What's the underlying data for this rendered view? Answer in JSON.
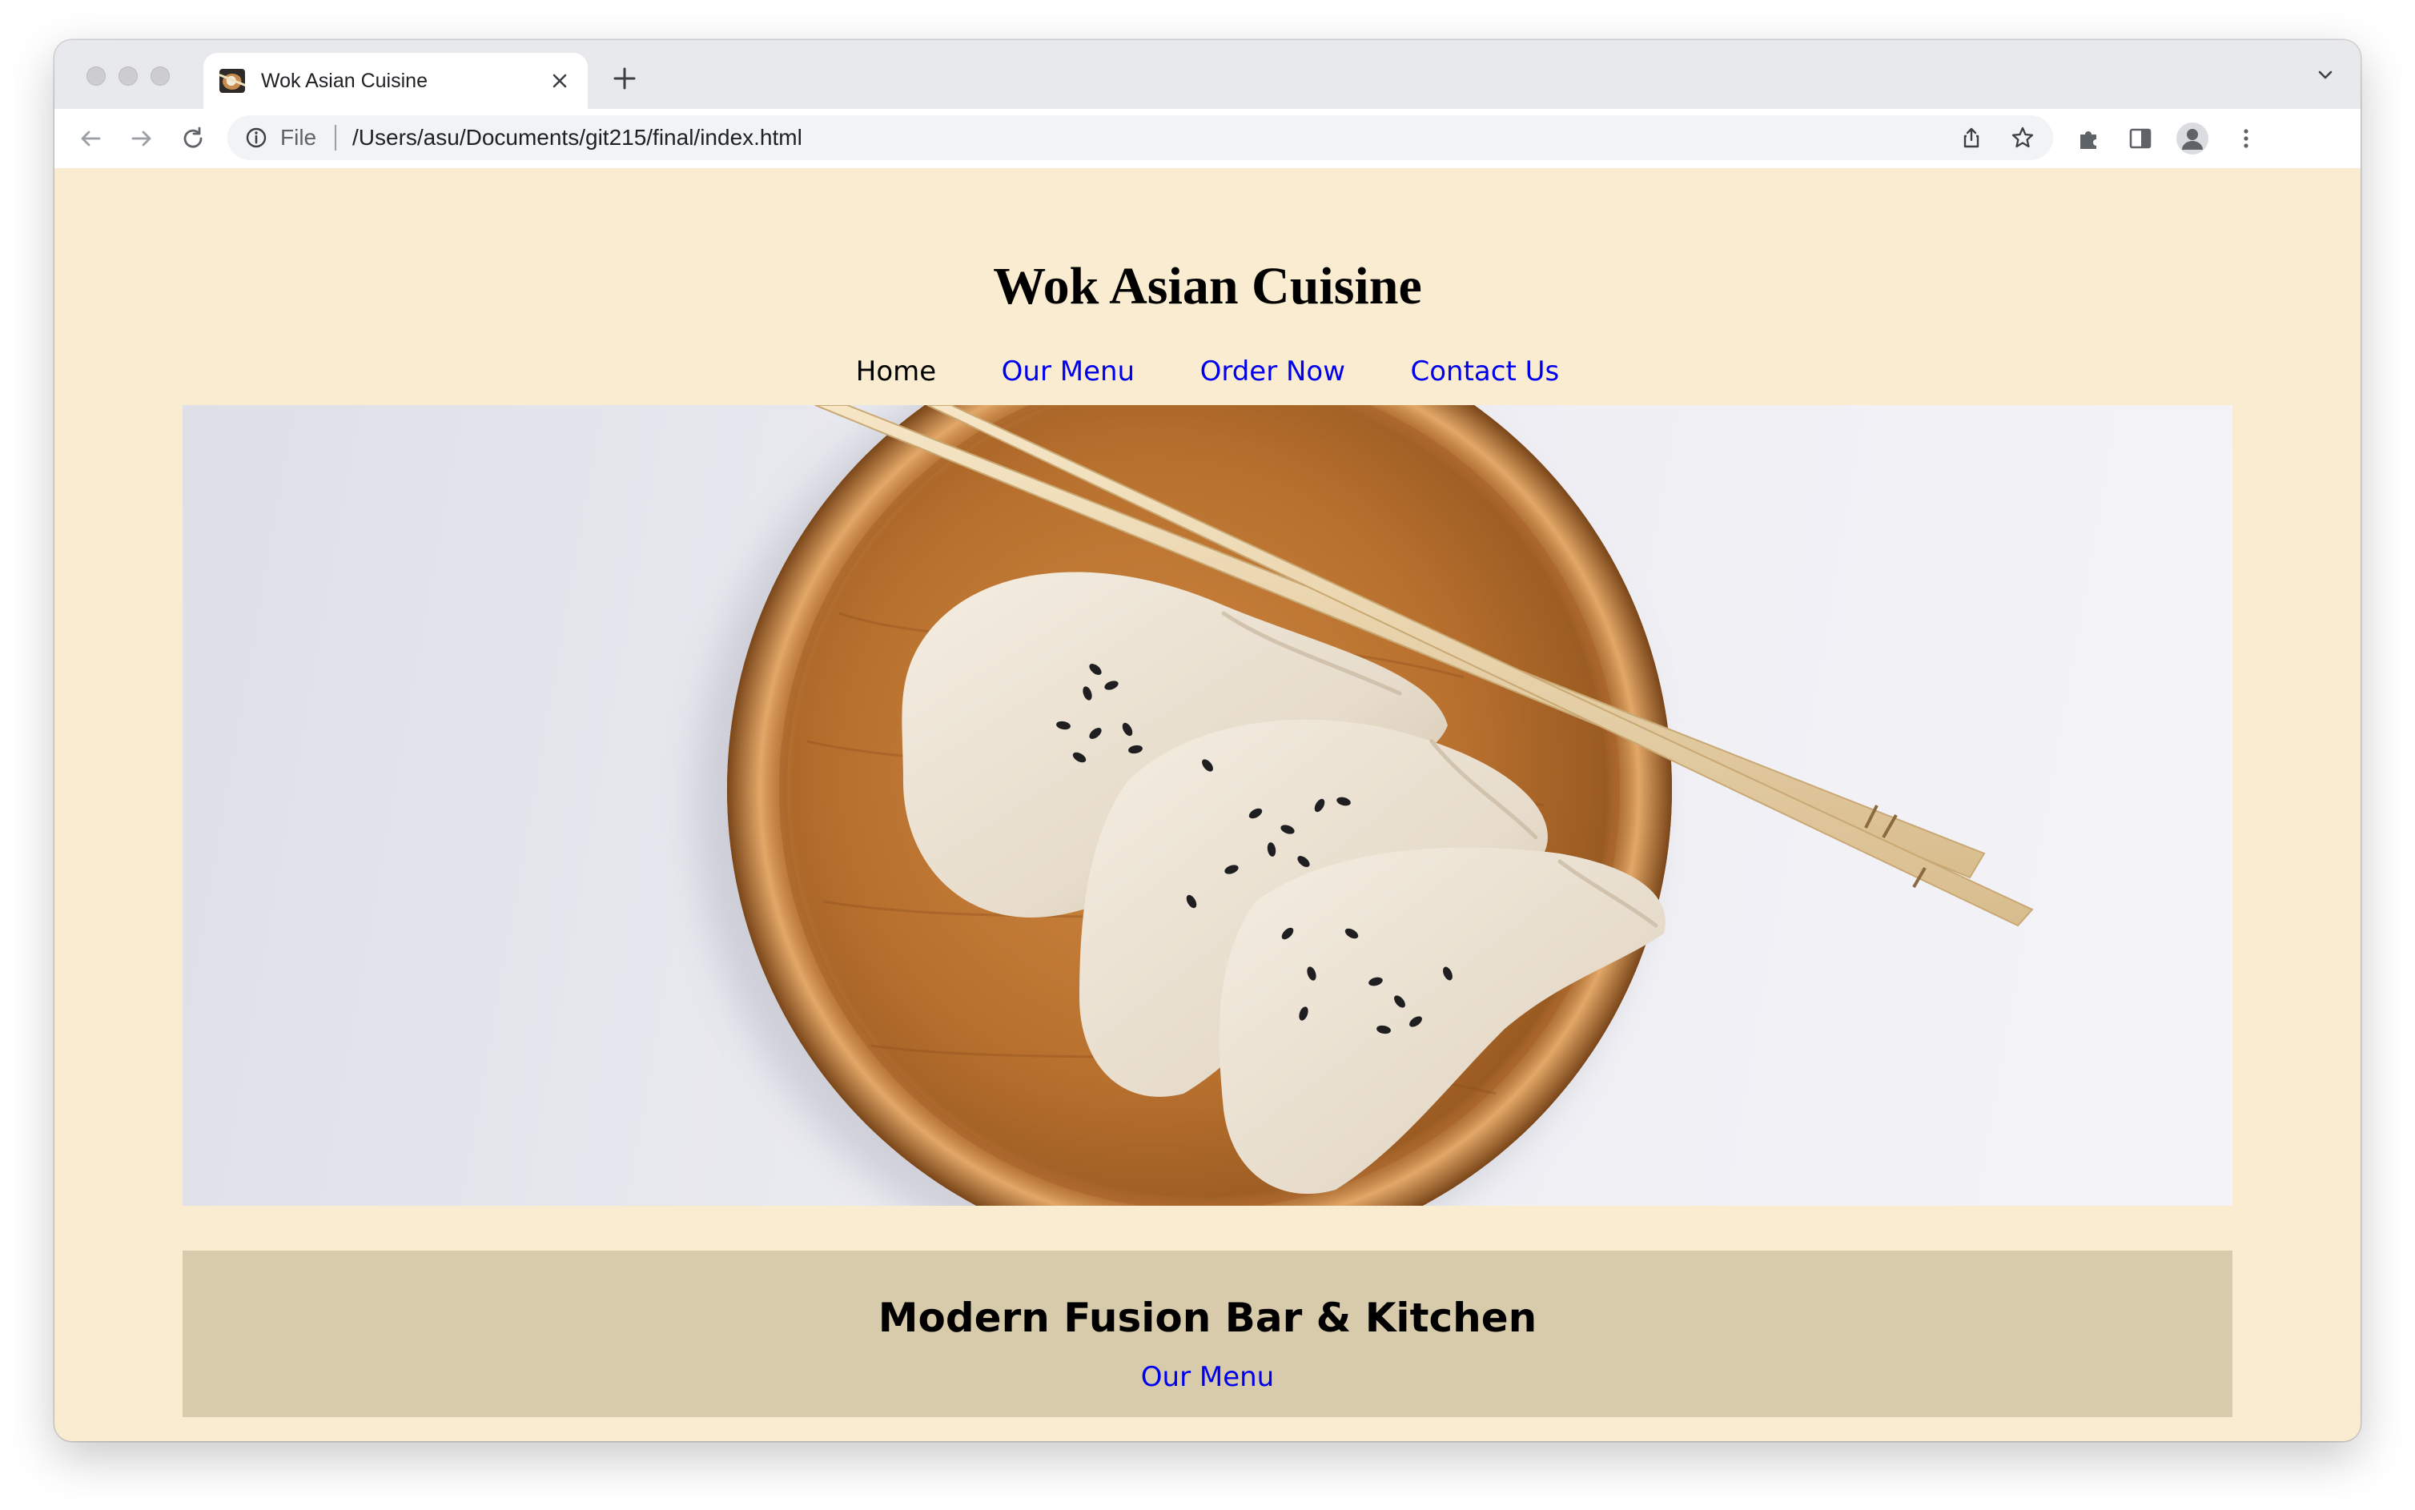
{
  "browser": {
    "tab_title": "Wok Asian Cuisine",
    "address_scheme": "File",
    "address_url": "/Users/asu/Documents/git215/final/index.html"
  },
  "site": {
    "title": "Wok Asian Cuisine",
    "nav": [
      {
        "label": "Home"
      },
      {
        "label": "Our Menu"
      },
      {
        "label": "Order Now"
      },
      {
        "label": "Contact Us"
      }
    ],
    "hero": {
      "image": "dumplings-on-wooden-plate-with-chopsticks"
    },
    "caption": {
      "title": "Modern Fusion Bar & Kitchen",
      "link": "Our Menu"
    }
  },
  "colors": {
    "page_background": "#f9ecd0",
    "caption_background": "#d8cbab",
    "link": "#0000ee",
    "tab_strip": "#e8e9ec"
  },
  "icons": [
    "back-icon",
    "forward-icon",
    "reload-icon",
    "info-icon",
    "share-icon",
    "star-icon",
    "extensions-icon",
    "side-panel-icon",
    "profile-icon",
    "menu-icon",
    "close-icon",
    "plus-icon",
    "chevron-down-icon"
  ]
}
